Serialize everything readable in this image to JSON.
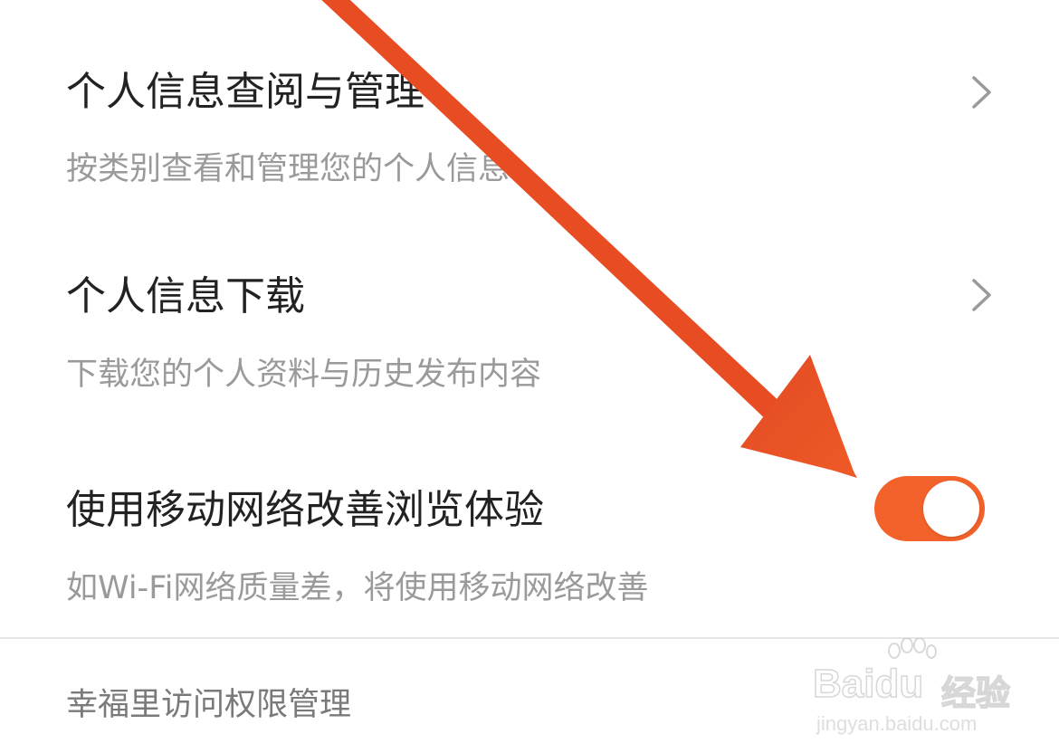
{
  "settings": {
    "items": [
      {
        "title": "个人信息查阅与管理",
        "subtitle": "按类别查看和管理您的个人信息",
        "control": "chevron-right-icon"
      },
      {
        "title": "个人信息下载",
        "subtitle": "下载您的个人资料与历史发布内容",
        "control": "chevron-right-icon"
      },
      {
        "title": "使用移动网络改善浏览体验",
        "subtitle": "如Wi-Fi网络质量差，将使用移动网络改善",
        "control": "toggle-switch",
        "toggle_on": true
      }
    ],
    "section_label": "幸福里访问权限管理"
  },
  "annotation": {
    "type": "arrow-icon",
    "color": "#e84c22"
  },
  "watermark": {
    "brand": "Baidu",
    "brand_cn": "经验",
    "url": "jingyan.baidu.com"
  },
  "colors": {
    "toggle_on": "#f2622a",
    "title_text": "#222222",
    "subtitle_text": "#9a9a9a",
    "divider": "#e6e6e6"
  }
}
